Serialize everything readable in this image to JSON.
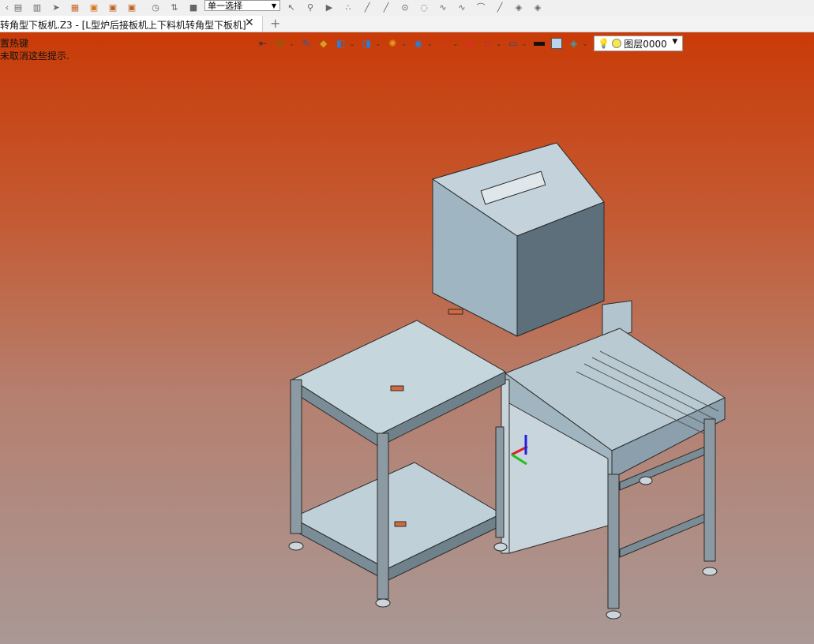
{
  "toolbar": {
    "select_mode": "单一选择"
  },
  "tab": {
    "title": "转角型下板机.Z3 - [L型炉后接板机上下料机转角型下板机]",
    "close_symbol": "✕",
    "add_symbol": "+"
  },
  "hints": {
    "line1": "置热键",
    "line2": "未取消这些提示."
  },
  "layer": {
    "name": "图层0000"
  },
  "icons": [
    "select-arrow-icon",
    "measure-icon",
    "layer-icon",
    "view-icon",
    "cube-icon",
    "render-icon",
    "filter-icon",
    "display-icon",
    "color-swatch-icon",
    "light-bulb-icon"
  ]
}
